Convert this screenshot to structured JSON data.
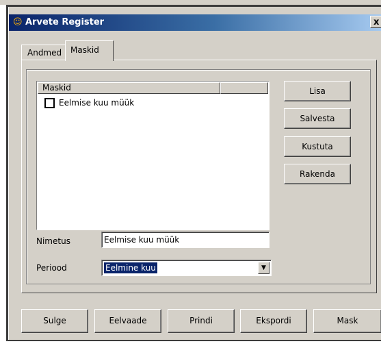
{
  "window": {
    "title": "Arvete Register",
    "close_glyph": "x"
  },
  "tabs": [
    {
      "label": "Andmed",
      "active": false
    },
    {
      "label": "Maskid",
      "active": true
    }
  ],
  "mask_list": {
    "columns": [
      "Maskid",
      ""
    ],
    "items": [
      {
        "label": "Eelmise kuu müük",
        "checked": false
      }
    ]
  },
  "side_buttons": {
    "add": "Lisa",
    "save": "Salvesta",
    "delete": "Kustuta",
    "apply": "Rakenda"
  },
  "form": {
    "name_label": "Nimetus",
    "name_value": "Eelmise kuu müük",
    "period_label": "Periood",
    "period_value": "Eelmine kuu"
  },
  "bottom_buttons": {
    "close": "Sulge",
    "preview": "Eelvaade",
    "print": "Prindi",
    "export": "Ekspordi",
    "mask": "Mask"
  },
  "colors": {
    "title_gradient_start": "#0a246a",
    "title_gradient_end": "#a6caf0",
    "face": "#d4d0c8",
    "selection": "#0a246a"
  }
}
